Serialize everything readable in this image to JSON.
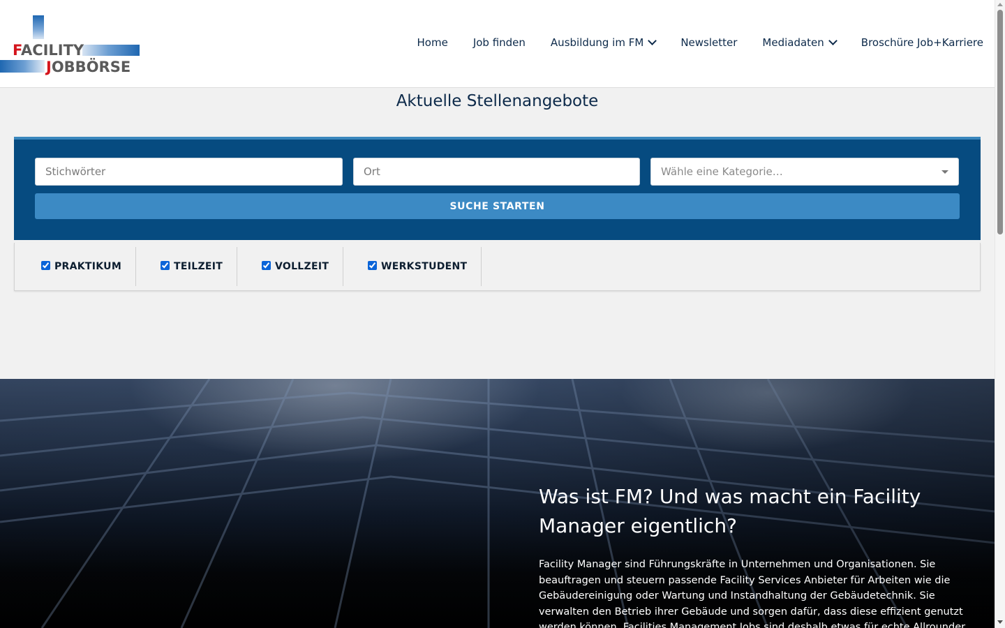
{
  "logo": {
    "line1_first": "F",
    "line1_rest": "ACILITY",
    "line2_first": "J",
    "line2_rest": "OBBÖRSE"
  },
  "nav": {
    "items": [
      {
        "label": "Home",
        "dropdown": false
      },
      {
        "label": "Job finden",
        "dropdown": false
      },
      {
        "label": "Ausbildung im FM",
        "dropdown": true
      },
      {
        "label": "Newsletter",
        "dropdown": false
      },
      {
        "label": "Mediadaten",
        "dropdown": true
      },
      {
        "label": "Broschüre Job+Karriere",
        "dropdown": false
      }
    ]
  },
  "page_title": "Aktuelle Stellenangebote",
  "search": {
    "keywords_placeholder": "Stichwörter",
    "location_placeholder": "Ort",
    "category_placeholder": "Wähle eine Kategorie…",
    "submit_label": "SUCHE STARTEN"
  },
  "filters": [
    {
      "label": "PRAKTIKUM",
      "checked": true
    },
    {
      "label": "TEILZEIT",
      "checked": true
    },
    {
      "label": "VOLLZEIT",
      "checked": true
    },
    {
      "label": "WERKSTUDENT",
      "checked": true
    }
  ],
  "hero": {
    "title": "Was ist FM? Und was macht ein Facility Manager eigentlich?",
    "text": "Facility Manager sind Führungskräfte in Unternehmen und Organisationen. Sie beauftragen und steuern passende Facility Services Anbieter für Arbeiten wie die Gebäudereinigung oder Wartung und Instandhaltung der Gebäudetechnik. Sie verwalten den Betrieb ihrer Gebäude und sorgen dafür, dass diese effizient genutzt werden können. Facilities Management Jobs sind deshalb etwas für echte Allrounder, denn der"
  },
  "colors": {
    "panel": "#064b80",
    "button": "#3c8ac4",
    "accent_red": "#d4141c",
    "text_dark": "#0d2a4a"
  }
}
